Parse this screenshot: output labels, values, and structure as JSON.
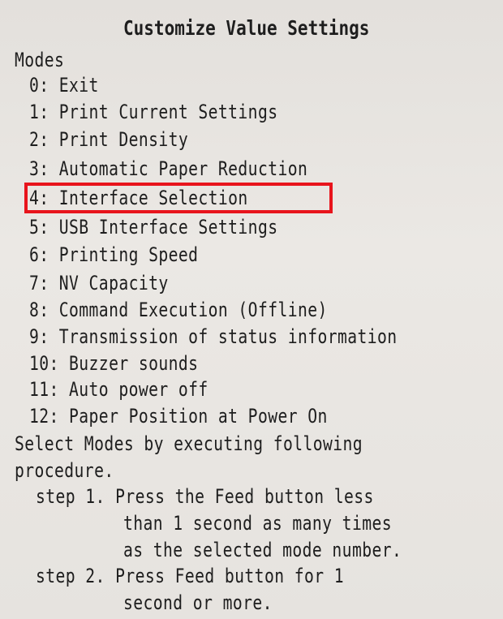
{
  "receipt": {
    "title": "Customize Value Settings",
    "modes_heading": "Modes",
    "modes": [
      "0: Exit",
      "1: Print Current Settings",
      "2: Print Density",
      "3: Automatic Paper Reduction",
      "4: Interface Selection",
      "5: USB Interface Settings",
      "6: Printing Speed",
      "7: NV Capacity",
      "8: Command Execution (Offline)",
      "9: Transmission of status information",
      "10: Buzzer sounds",
      "11: Auto power off",
      "12: Paper Position at Power On"
    ],
    "instruction_line1": "Select Modes by executing following",
    "instruction_line2": "procedure.",
    "step1_line1": "step 1. Press the Feed button less",
    "step1_line2": "than 1 second as many times",
    "step1_line3": "as the selected mode number.",
    "step2_line1": "step 2. Press Feed button for 1",
    "step2_line2": "second or more."
  },
  "highlight": {
    "color": "#e8141c",
    "target": "4: Interface Selection"
  }
}
